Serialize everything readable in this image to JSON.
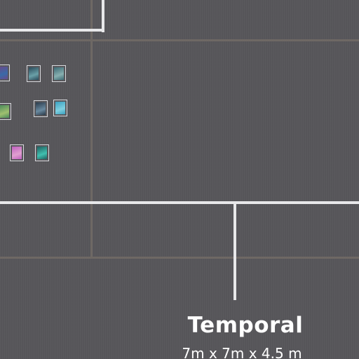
{
  "room": {
    "name": "Temporal",
    "dimensions": "7m x 7m x 4.5 m"
  },
  "artworks": [
    {
      "name": "artwork-1",
      "colors": [
        "#6a4a8a",
        "#3a6aa8"
      ]
    },
    {
      "name": "artwork-2",
      "colors": [
        "#2a4a5a",
        "#6aa0a8"
      ]
    },
    {
      "name": "artwork-3",
      "colors": [
        "#3c6a74",
        "#88b0b0"
      ]
    },
    {
      "name": "artwork-4",
      "colors": [
        "#4a8a5a",
        "#a0c070"
      ]
    },
    {
      "name": "artwork-5",
      "colors": [
        "#2a3a4a",
        "#6a8aa0"
      ]
    },
    {
      "name": "artwork-6",
      "colors": [
        "#3aa0c0",
        "#80d0e0"
      ]
    },
    {
      "name": "artwork-7",
      "colors": [
        "#c060c0",
        "#e0a0d0"
      ]
    },
    {
      "name": "artwork-8",
      "colors": [
        "#206060",
        "#40c0b0"
      ]
    }
  ],
  "colors": {
    "floor": "#58575b",
    "wall": "#e8e8ea",
    "grid": "#6e6864",
    "label": "#ffffff"
  }
}
